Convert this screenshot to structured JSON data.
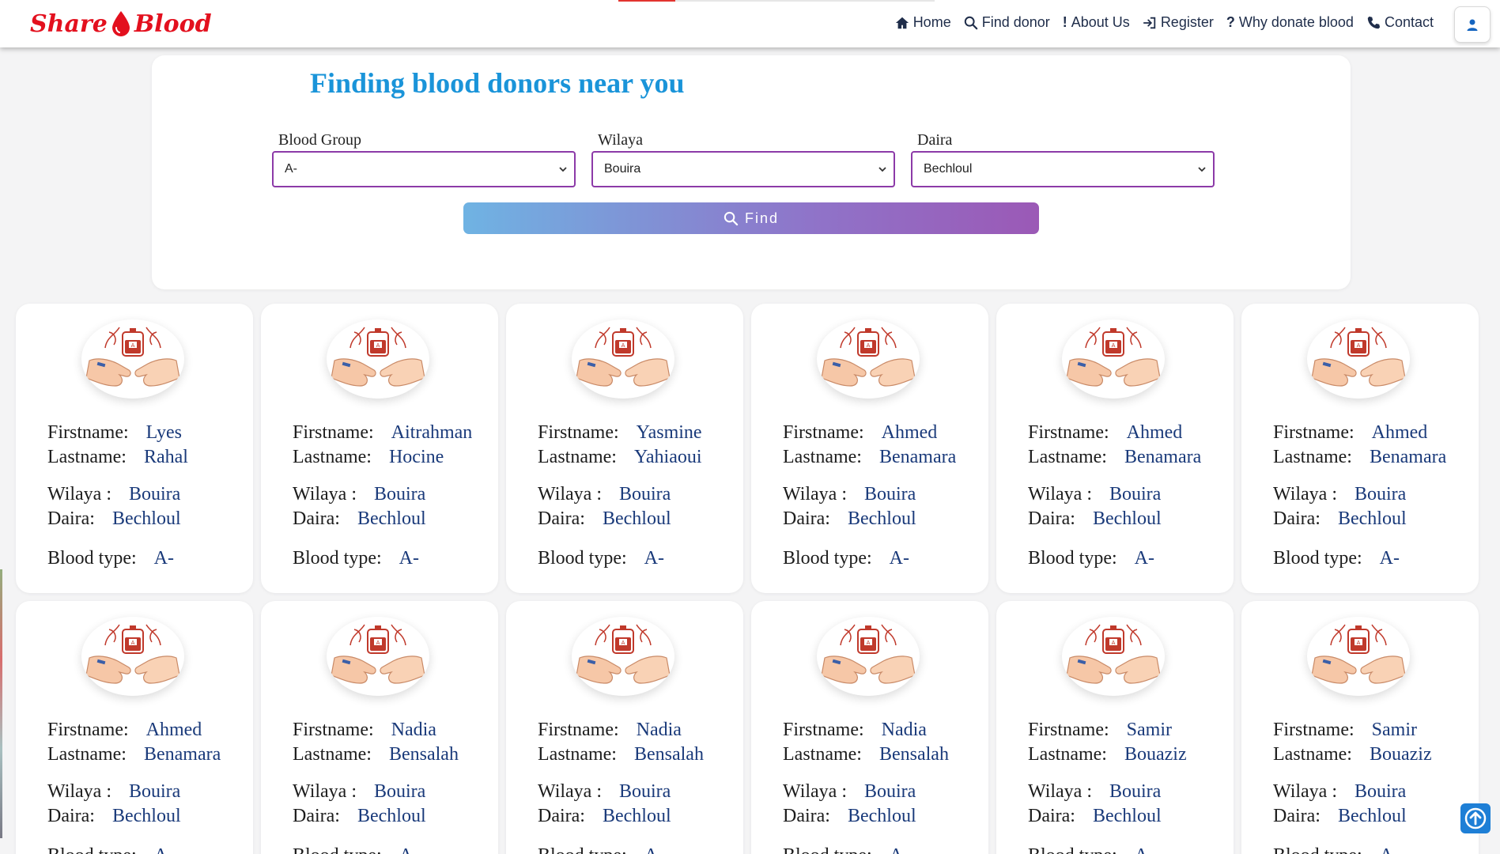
{
  "brand": {
    "part1": "Share",
    "part2": "Blood",
    "color": "#e3101e"
  },
  "nav": {
    "items": [
      {
        "label": "Home",
        "icon": "home-icon"
      },
      {
        "label": "Find donor",
        "icon": "search-icon"
      },
      {
        "label": "About Us",
        "icon": "exclamation-icon"
      },
      {
        "label": "Register",
        "icon": "sign-in-icon"
      },
      {
        "label": "Why donate blood",
        "icon": "question-icon"
      },
      {
        "label": "Contact",
        "icon": "phone-icon"
      }
    ],
    "user_icon": "user-icon"
  },
  "search": {
    "title": "Finding blood donors near you",
    "blood_group": {
      "label": "Blood Group",
      "value": "A-"
    },
    "wilaya": {
      "label": "Wilaya",
      "value": "Bouira"
    },
    "daira": {
      "label": "Daira",
      "value": "Bechloul"
    },
    "find_label": "Find",
    "accent": "#1a94d9"
  },
  "labels": {
    "firstname": "Firstname:",
    "lastname": "Lastname:",
    "wilaya": "Wilaya :",
    "daira": "Daira:",
    "blood_type": "Blood type:"
  },
  "donors": [
    {
      "firstname": "Lyes",
      "lastname": "Rahal",
      "wilaya": "Bouira",
      "daira": "Bechloul",
      "blood_type": "A-"
    },
    {
      "firstname": "Aitrahman",
      "lastname": "Hocine",
      "wilaya": "Bouira",
      "daira": "Bechloul",
      "blood_type": "A-"
    },
    {
      "firstname": "Yasmine",
      "lastname": "Yahiaoui",
      "wilaya": "Bouira",
      "daira": "Bechloul",
      "blood_type": "A-"
    },
    {
      "firstname": "Ahmed",
      "lastname": "Benamara",
      "wilaya": "Bouira",
      "daira": "Bechloul",
      "blood_type": "A-"
    },
    {
      "firstname": "Ahmed",
      "lastname": "Benamara",
      "wilaya": "Bouira",
      "daira": "Bechloul",
      "blood_type": "A-"
    },
    {
      "firstname": "Ahmed",
      "lastname": "Benamara",
      "wilaya": "Bouira",
      "daira": "Bechloul",
      "blood_type": "A-"
    },
    {
      "firstname": "Ahmed",
      "lastname": "Benamara",
      "wilaya": "Bouira",
      "daira": "Bechloul",
      "blood_type": "A-"
    },
    {
      "firstname": "Nadia",
      "lastname": "Bensalah",
      "wilaya": "Bouira",
      "daira": "Bechloul",
      "blood_type": "A-"
    },
    {
      "firstname": "Nadia",
      "lastname": "Bensalah",
      "wilaya": "Bouira",
      "daira": "Bechloul",
      "blood_type": "A-"
    },
    {
      "firstname": "Nadia",
      "lastname": "Bensalah",
      "wilaya": "Bouira",
      "daira": "Bechloul",
      "blood_type": "A-"
    },
    {
      "firstname": "Samir",
      "lastname": "Bouaziz",
      "wilaya": "Bouira",
      "daira": "Bechloul",
      "blood_type": "A-"
    },
    {
      "firstname": "Samir",
      "lastname": "Bouaziz",
      "wilaya": "Bouira",
      "daira": "Bechloul",
      "blood_type": "A-"
    }
  ],
  "card_icon": "blood-donation-icon",
  "scroll_top_icon": "arrow-up-icon"
}
